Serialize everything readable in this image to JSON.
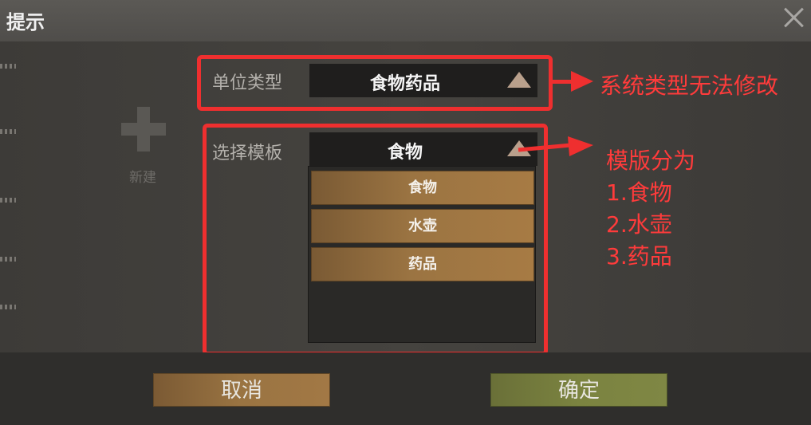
{
  "dialog": {
    "title": "提示"
  },
  "background": {
    "new_label": "新建"
  },
  "unit_type": {
    "label": "单位类型",
    "value": "食物药品"
  },
  "template": {
    "label": "选择模板",
    "value": "食物",
    "options": [
      "食物",
      "水壶",
      "药品"
    ]
  },
  "annotations": {
    "note1": "系统类型无法修改",
    "note2_lines": [
      "模版分为",
      "1.食物",
      "2.水壶",
      "3.药品"
    ],
    "color": "#ef2f2f"
  },
  "footer": {
    "cancel_label": "取消",
    "confirm_label": "确定"
  }
}
